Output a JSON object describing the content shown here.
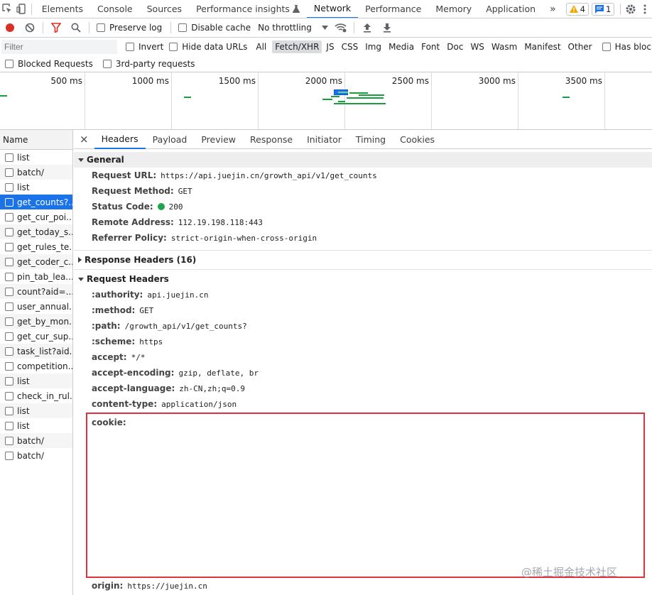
{
  "tabbar": {
    "tabs": [
      "Elements",
      "Console",
      "Sources",
      "Performance insights",
      "Network",
      "Performance",
      "Memory",
      "Application"
    ],
    "active": "Network",
    "more": "»",
    "warnings": "4",
    "messages": "1"
  },
  "toolbar": {
    "preserve_log": "Preserve log",
    "disable_cache": "Disable cache",
    "throttling": "No throttling"
  },
  "filterbar": {
    "placeholder": "Filter",
    "invert": "Invert",
    "hide_data_urls": "Hide data URLs",
    "types": [
      "All",
      "Fetch/XHR",
      "JS",
      "CSS",
      "Img",
      "Media",
      "Font",
      "Doc",
      "WS",
      "Wasm",
      "Manifest",
      "Other"
    ],
    "active_type": "Fetch/XHR",
    "blocked_cookies": "Has blocked cookies",
    "blocked_requests": "Blocked Requests",
    "third_party": "3rd-party requests"
  },
  "overview": {
    "labels": [
      "500 ms",
      "1000 ms",
      "1500 ms",
      "2000 ms",
      "2500 ms",
      "3000 ms",
      "3500 ms"
    ]
  },
  "requests": {
    "header": "Name",
    "items": [
      "list",
      "batch/",
      "list",
      "get_counts?...",
      "get_cur_poi...",
      "get_today_s...",
      "get_rules_te...",
      "get_coder_c...",
      "pin_tab_lea...",
      "count?aid=...",
      "user_annual...",
      "get_by_mon...",
      "get_cur_sup...",
      "task_list?aid...",
      "competition...",
      "list",
      "check_in_rul...",
      "list",
      "list",
      "batch/",
      "batch/"
    ],
    "selected_index": 3
  },
  "details": {
    "close": "×",
    "tabs": [
      "Headers",
      "Payload",
      "Preview",
      "Response",
      "Initiator",
      "Timing",
      "Cookies"
    ],
    "active_tab": "Headers",
    "general": {
      "title": "General",
      "rows": [
        {
          "k": "Request URL:",
          "v": "https://api.juejin.cn/growth_api/v1/get_counts"
        },
        {
          "k": "Request Method:",
          "v": "GET"
        },
        {
          "k": "Status Code:",
          "v": "200"
        },
        {
          "k": "Remote Address:",
          "v": "112.19.198.118:443"
        },
        {
          "k": "Referrer Policy:",
          "v": "strict-origin-when-cross-origin"
        }
      ]
    },
    "response_headers_title": "Response Headers (16)",
    "request_headers": {
      "title": "Request Headers",
      "rows": [
        {
          "k": ":authority:",
          "v": "api.juejin.cn"
        },
        {
          "k": ":method:",
          "v": "GET"
        },
        {
          "k": ":path:",
          "v": "/growth_api/v1/get_counts?"
        },
        {
          "k": ":scheme:",
          "v": "https"
        },
        {
          "k": "accept:",
          "v": "*/*"
        },
        {
          "k": "accept-encoding:",
          "v": "gzip, deflate, br"
        },
        {
          "k": "accept-language:",
          "v": "zh-CN,zh;q=0.9"
        },
        {
          "k": "content-type:",
          "v": "application/json"
        }
      ],
      "cookie_key": "cookie:",
      "origin_key": "origin:",
      "origin_value": "https://juejin.cn"
    }
  },
  "watermark": "@稀土掘金技术社区",
  "colors": {
    "accent": "#1a73e8",
    "status_ok": "#1ea64a",
    "highlight_box": "#e0323a",
    "waterfall": "#1a9f3f"
  }
}
